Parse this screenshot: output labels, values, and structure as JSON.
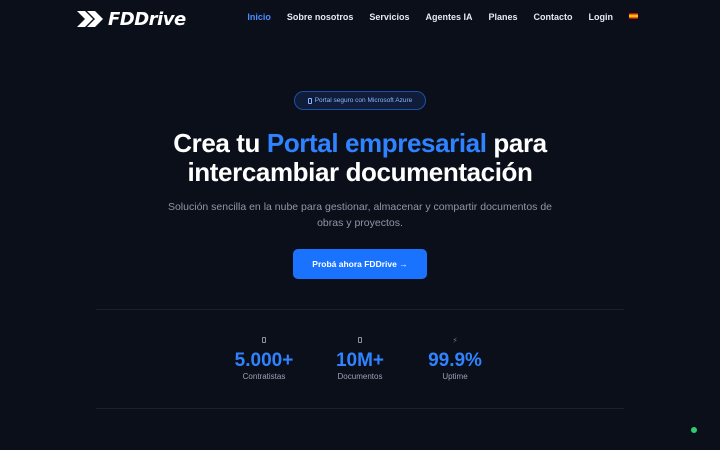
{
  "brand": {
    "name": "FDDrive"
  },
  "nav": {
    "items": [
      {
        "label": "Inicio",
        "active": true
      },
      {
        "label": "Sobre nosotros",
        "active": false
      },
      {
        "label": "Servicios",
        "active": false
      },
      {
        "label": "Agentes IA",
        "active": false
      },
      {
        "label": "Planes",
        "active": false
      },
      {
        "label": "Contacto",
        "active": false
      },
      {
        "label": "Login",
        "active": false
      }
    ],
    "language_icon": "spain-flag-icon"
  },
  "hero": {
    "badge": "Portal seguro con Microsoft Azure",
    "headline_part1": "Crea tu ",
    "headline_accent": "Portal empresarial",
    "headline_part2": " para",
    "headline_line2": "intercambiar documentación",
    "subtitle": "Solución sencilla en la nube para gestionar, almacenar y compartir documentos de obras y proyectos.",
    "cta_label": "Probá ahora FDDrive →"
  },
  "stats": [
    {
      "icon": "building-icon",
      "value": "5.000+",
      "label": "Contratistas"
    },
    {
      "icon": "document-icon",
      "value": "10M+",
      "label": "Documentos"
    },
    {
      "icon": "lightning-icon",
      "value": "99.9%",
      "label": "Uptime"
    }
  ],
  "colors": {
    "background": "#0b0f1a",
    "accent": "#2f83ff",
    "cta": "#1a73ff",
    "status": "#2ecc71"
  }
}
